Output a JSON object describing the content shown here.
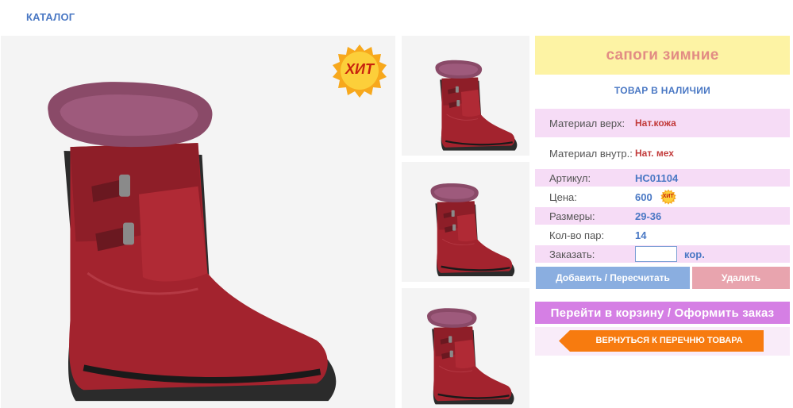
{
  "nav": {
    "catalog": "КАТАЛОГ"
  },
  "badge": {
    "hit": "ХИТ",
    "mini_hit": "ХИТ"
  },
  "product": {
    "title": "сапоги зимние",
    "stock": "ТОВАР В НАЛИЧИИ",
    "fields": {
      "material_top": {
        "label": "Материал верх:",
        "value": "Нат.кожа"
      },
      "material_in": {
        "label": "Материал внутр.:",
        "value": "Нат. мех"
      },
      "article": {
        "label": "Артикул:",
        "value": "НС01104"
      },
      "price": {
        "label": "Цена:",
        "value": "600"
      },
      "sizes": {
        "label": "Размеры:",
        "value": "29-36"
      },
      "pairs": {
        "label": "Кол-во пар:",
        "value": "14"
      },
      "order": {
        "label": "Заказать:",
        "unit": "кор.",
        "qty": ""
      }
    }
  },
  "actions": {
    "add": "Добавить / Пересчитать",
    "delete": "Удалить",
    "cart": "Перейти в корзину / Оформить заказ",
    "back": "ВЕРНУТЬСЯ К ПЕРЕЧНЮ ТОВАРА"
  },
  "colors": {
    "accent_blue": "#4a78c4",
    "title_bg": "#fdf3a4",
    "title_text": "#e28c84",
    "row_pink": "#f6dcf6",
    "cart_purple": "#d57fe4",
    "back_orange": "#f77b0f"
  }
}
